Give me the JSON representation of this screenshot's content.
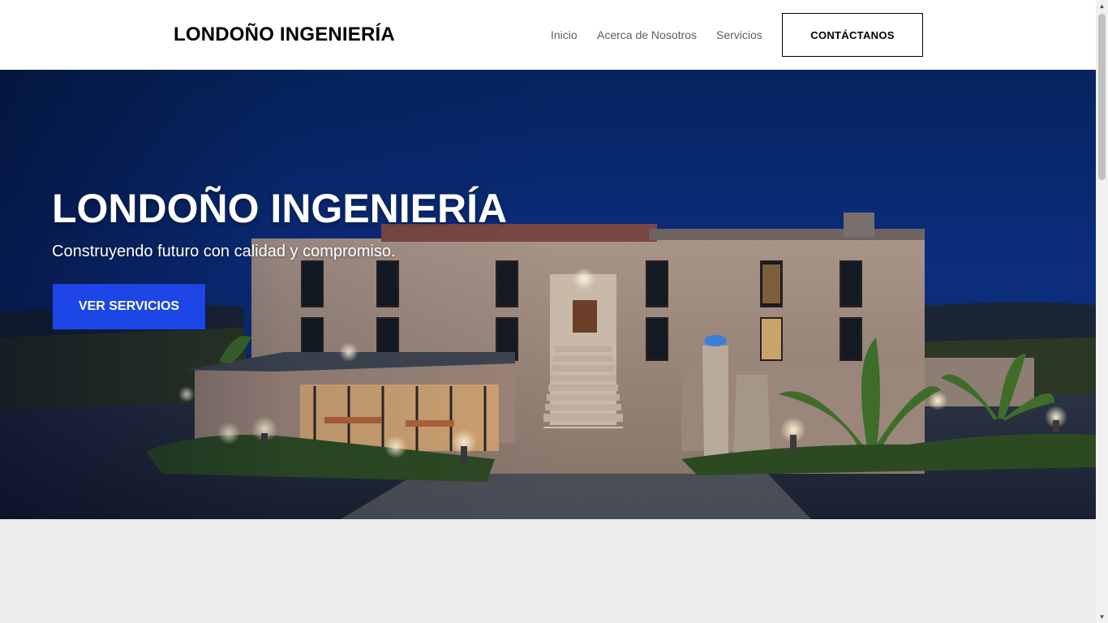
{
  "header": {
    "brand": "LONDOÑO INGENIERÍA",
    "nav": [
      {
        "label": "Inicio"
      },
      {
        "label": "Acerca de Nosotros"
      },
      {
        "label": "Servicios"
      }
    ],
    "cta_label": "CONTÁCTANOS"
  },
  "hero": {
    "title": "LONDOÑO INGENIERÍA",
    "subtitle": "Construyendo futuro con calidad y compromiso.",
    "button_label": "VER SERVICIOS",
    "image": "building-at-night-photo"
  },
  "colors": {
    "primary_button": "#1c47e6",
    "night_sky": "#0b2a7a",
    "background": "#ececec"
  },
  "icons": {
    "scroll_up": "▲",
    "scroll_down": "▼"
  }
}
